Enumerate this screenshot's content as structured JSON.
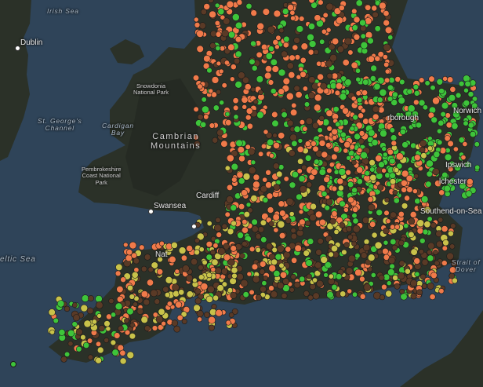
{
  "map": {
    "colors": {
      "sea": "#2f4459",
      "land": "#2b3027",
      "orange_marker": "#f07a4a",
      "green_marker": "#3ec43a",
      "brown_marker": "#5a3a26",
      "yellow_marker": "#c8c24a"
    },
    "labels": {
      "irish_sea": "Irish Sea",
      "dublin": "Dublin",
      "st_georges_1": "St. George's",
      "st_georges_2": "Channel",
      "cardigan_1": "Cardigan",
      "cardigan_2": "Bay",
      "snowdonia_1": "Snowdonia",
      "snowdonia_2": "National Park",
      "cambrian_1": "Cambrian",
      "cambrian_2": "Mountains",
      "pembrokeshire_1": "Pembrokeshire",
      "pembrokeshire_2": "Coast National",
      "pembrokeshire_3": "Park",
      "swansea": "Swansea",
      "cardiff": "Cardiff",
      "celtic_sea": "eltic Sea",
      "norwich": "Norwich",
      "ipswich": "Ipswich",
      "colchester": "lchester",
      "southend": "Southend-on-Sea",
      "dover_1": "Strait of",
      "dover_2": "Dover",
      "peterborough": "rborough",
      "nat": "Nat"
    }
  }
}
